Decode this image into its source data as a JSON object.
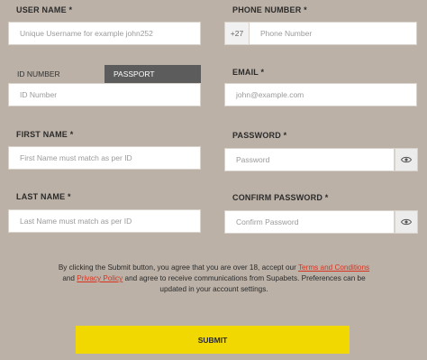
{
  "username": {
    "label": "USER NAME *",
    "placeholder": "Unique Username for example john252"
  },
  "phone": {
    "label": "PHONE NUMBER *",
    "prefix": "+27",
    "placeholder": "Phone Number"
  },
  "id_type": {
    "tabs": [
      "ID NUMBER",
      "PASSPORT"
    ],
    "selected": "PASSPORT",
    "placeholder": "ID Number"
  },
  "email": {
    "label": "EMAIL *",
    "placeholder": "john@example.com"
  },
  "first_name": {
    "label": "FIRST NAME *",
    "placeholder": "First Name must match as per ID"
  },
  "password": {
    "label": "PASSWORD *",
    "placeholder": "Password",
    "toggle_icon": "eye-icon"
  },
  "last_name": {
    "label": "LAST NAME *",
    "placeholder": "Last Name must match as per ID"
  },
  "confirm_password": {
    "label": "CONFIRM PASSWORD *",
    "placeholder": "Confirm Password",
    "toggle_icon": "eye-icon"
  },
  "consent": {
    "text_1": "By clicking the Submit button, you agree that you are over 18, accept our ",
    "terms_link": "Terms and Conditions",
    "text_2": " and ",
    "privacy_link": "Privacy Policy",
    "text_3": " and agree to receive communications from Supabets. Preferences can be updated in your account settings."
  },
  "submit": {
    "label": "SUBMIT"
  },
  "colors": {
    "background": "#bbb1a7",
    "submit": "#f1d800",
    "link": "#d9331f",
    "active_tab": "#5c5c5c"
  }
}
